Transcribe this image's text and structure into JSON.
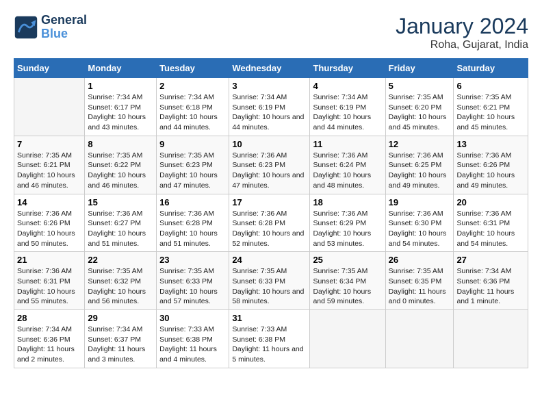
{
  "logo": {
    "line1": "General",
    "line2": "Blue"
  },
  "title": "January 2024",
  "subtitle": "Roha, Gujarat, India",
  "days_of_week": [
    "Sunday",
    "Monday",
    "Tuesday",
    "Wednesday",
    "Thursday",
    "Friday",
    "Saturday"
  ],
  "weeks": [
    [
      {
        "day": "",
        "sunrise": "",
        "sunset": "",
        "daylight": ""
      },
      {
        "day": "1",
        "sunrise": "Sunrise: 7:34 AM",
        "sunset": "Sunset: 6:17 PM",
        "daylight": "Daylight: 10 hours and 43 minutes."
      },
      {
        "day": "2",
        "sunrise": "Sunrise: 7:34 AM",
        "sunset": "Sunset: 6:18 PM",
        "daylight": "Daylight: 10 hours and 44 minutes."
      },
      {
        "day": "3",
        "sunrise": "Sunrise: 7:34 AM",
        "sunset": "Sunset: 6:19 PM",
        "daylight": "Daylight: 10 hours and 44 minutes."
      },
      {
        "day": "4",
        "sunrise": "Sunrise: 7:34 AM",
        "sunset": "Sunset: 6:19 PM",
        "daylight": "Daylight: 10 hours and 44 minutes."
      },
      {
        "day": "5",
        "sunrise": "Sunrise: 7:35 AM",
        "sunset": "Sunset: 6:20 PM",
        "daylight": "Daylight: 10 hours and 45 minutes."
      },
      {
        "day": "6",
        "sunrise": "Sunrise: 7:35 AM",
        "sunset": "Sunset: 6:21 PM",
        "daylight": "Daylight: 10 hours and 45 minutes."
      }
    ],
    [
      {
        "day": "7",
        "sunrise": "Sunrise: 7:35 AM",
        "sunset": "Sunset: 6:21 PM",
        "daylight": "Daylight: 10 hours and 46 minutes."
      },
      {
        "day": "8",
        "sunrise": "Sunrise: 7:35 AM",
        "sunset": "Sunset: 6:22 PM",
        "daylight": "Daylight: 10 hours and 46 minutes."
      },
      {
        "day": "9",
        "sunrise": "Sunrise: 7:35 AM",
        "sunset": "Sunset: 6:23 PM",
        "daylight": "Daylight: 10 hours and 47 minutes."
      },
      {
        "day": "10",
        "sunrise": "Sunrise: 7:36 AM",
        "sunset": "Sunset: 6:23 PM",
        "daylight": "Daylight: 10 hours and 47 minutes."
      },
      {
        "day": "11",
        "sunrise": "Sunrise: 7:36 AM",
        "sunset": "Sunset: 6:24 PM",
        "daylight": "Daylight: 10 hours and 48 minutes."
      },
      {
        "day": "12",
        "sunrise": "Sunrise: 7:36 AM",
        "sunset": "Sunset: 6:25 PM",
        "daylight": "Daylight: 10 hours and 49 minutes."
      },
      {
        "day": "13",
        "sunrise": "Sunrise: 7:36 AM",
        "sunset": "Sunset: 6:26 PM",
        "daylight": "Daylight: 10 hours and 49 minutes."
      }
    ],
    [
      {
        "day": "14",
        "sunrise": "Sunrise: 7:36 AM",
        "sunset": "Sunset: 6:26 PM",
        "daylight": "Daylight: 10 hours and 50 minutes."
      },
      {
        "day": "15",
        "sunrise": "Sunrise: 7:36 AM",
        "sunset": "Sunset: 6:27 PM",
        "daylight": "Daylight: 10 hours and 51 minutes."
      },
      {
        "day": "16",
        "sunrise": "Sunrise: 7:36 AM",
        "sunset": "Sunset: 6:28 PM",
        "daylight": "Daylight: 10 hours and 51 minutes."
      },
      {
        "day": "17",
        "sunrise": "Sunrise: 7:36 AM",
        "sunset": "Sunset: 6:28 PM",
        "daylight": "Daylight: 10 hours and 52 minutes."
      },
      {
        "day": "18",
        "sunrise": "Sunrise: 7:36 AM",
        "sunset": "Sunset: 6:29 PM",
        "daylight": "Daylight: 10 hours and 53 minutes."
      },
      {
        "day": "19",
        "sunrise": "Sunrise: 7:36 AM",
        "sunset": "Sunset: 6:30 PM",
        "daylight": "Daylight: 10 hours and 54 minutes."
      },
      {
        "day": "20",
        "sunrise": "Sunrise: 7:36 AM",
        "sunset": "Sunset: 6:31 PM",
        "daylight": "Daylight: 10 hours and 54 minutes."
      }
    ],
    [
      {
        "day": "21",
        "sunrise": "Sunrise: 7:36 AM",
        "sunset": "Sunset: 6:31 PM",
        "daylight": "Daylight: 10 hours and 55 minutes."
      },
      {
        "day": "22",
        "sunrise": "Sunrise: 7:35 AM",
        "sunset": "Sunset: 6:32 PM",
        "daylight": "Daylight: 10 hours and 56 minutes."
      },
      {
        "day": "23",
        "sunrise": "Sunrise: 7:35 AM",
        "sunset": "Sunset: 6:33 PM",
        "daylight": "Daylight: 10 hours and 57 minutes."
      },
      {
        "day": "24",
        "sunrise": "Sunrise: 7:35 AM",
        "sunset": "Sunset: 6:33 PM",
        "daylight": "Daylight: 10 hours and 58 minutes."
      },
      {
        "day": "25",
        "sunrise": "Sunrise: 7:35 AM",
        "sunset": "Sunset: 6:34 PM",
        "daylight": "Daylight: 10 hours and 59 minutes."
      },
      {
        "day": "26",
        "sunrise": "Sunrise: 7:35 AM",
        "sunset": "Sunset: 6:35 PM",
        "daylight": "Daylight: 11 hours and 0 minutes."
      },
      {
        "day": "27",
        "sunrise": "Sunrise: 7:34 AM",
        "sunset": "Sunset: 6:36 PM",
        "daylight": "Daylight: 11 hours and 1 minute."
      }
    ],
    [
      {
        "day": "28",
        "sunrise": "Sunrise: 7:34 AM",
        "sunset": "Sunset: 6:36 PM",
        "daylight": "Daylight: 11 hours and 2 minutes."
      },
      {
        "day": "29",
        "sunrise": "Sunrise: 7:34 AM",
        "sunset": "Sunset: 6:37 PM",
        "daylight": "Daylight: 11 hours and 3 minutes."
      },
      {
        "day": "30",
        "sunrise": "Sunrise: 7:33 AM",
        "sunset": "Sunset: 6:38 PM",
        "daylight": "Daylight: 11 hours and 4 minutes."
      },
      {
        "day": "31",
        "sunrise": "Sunrise: 7:33 AM",
        "sunset": "Sunset: 6:38 PM",
        "daylight": "Daylight: 11 hours and 5 minutes."
      },
      {
        "day": "",
        "sunrise": "",
        "sunset": "",
        "daylight": ""
      },
      {
        "day": "",
        "sunrise": "",
        "sunset": "",
        "daylight": ""
      },
      {
        "day": "",
        "sunrise": "",
        "sunset": "",
        "daylight": ""
      }
    ]
  ]
}
